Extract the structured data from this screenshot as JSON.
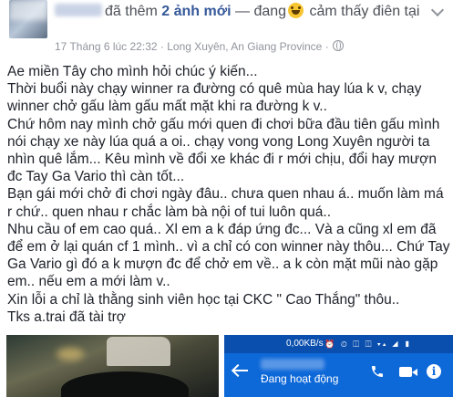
{
  "header": {
    "status_prefix": "đã thêm",
    "status_added": "2 ảnh mới",
    "status_feeling_prefix": "— đang",
    "status_feeling": "cảm thấy điên tại",
    "timestamp": "17 Tháng 6 lúc 22:32",
    "separator": "·",
    "location": "Long Xuyên, An Giang Province",
    "location_separator": "·",
    "privacy_icon": "globe-icon",
    "menu_icon": "chevron-down-icon"
  },
  "post": {
    "paragraphs": [
      "Ae miền Tây cho mình hỏi chúc ý kiến...",
      "Thời buổi này chạy winner ra đường có quê mùa hay lúa k v, chạy winner chở gấu làm gấu mất mặt khi ra đường k v..",
      "Chứ hôm nay mình chở gấu mới quen đi chơi bữa đầu tiên gấu mình nói chạy xe này lúa quá a oi.. chạy vong vong Long Xuyên người ta nhìn quê lắm... Kêu mình về đổi xe khác đi r mới chịu, đổi hay mượn đc Tay Ga Vario thì càn tốt...",
      "Bạn gái mới chở đi chơi ngày đâu.. chưa quen nhau á.. muốn làm má r chứ.. quen nhau r chắc làm bà nội of tui luôn quá..",
      "Nhu cầu of em cao quá.. Xl em a k đáp ứng đc... Và a cũng xl em đã để em ở lại quán cf 1 mình.. vì a chỉ có con winner này thôu... Chứ Tay Ga Vario gì đó a k mượn đc để chở em về.. a k còn mặt mũi nào gặp em.. nếu em a mới làm v..",
      "Xin lỗi a chỉ là thằng sinh viên học tại CKC \" Cao Thắng\" thôu..",
      "Tks a.trai đã tài trợ"
    ]
  },
  "photos": {
    "phone_speed": "0,00KB/s",
    "phone_signals": "⏰ ⏲ ◫ ◫ ▾▴ ◢ ▮",
    "phone_presence": "Đang hoạt động",
    "phone_call_icon": "phone-icon",
    "phone_video_icon": "video-camera-icon",
    "phone_info_icon": "info-icon",
    "info_glyph": "i"
  },
  "colors": {
    "link": "#365899",
    "meta": "#90949c",
    "text": "#1d2129",
    "messenger_blue": "#0d68d8"
  }
}
